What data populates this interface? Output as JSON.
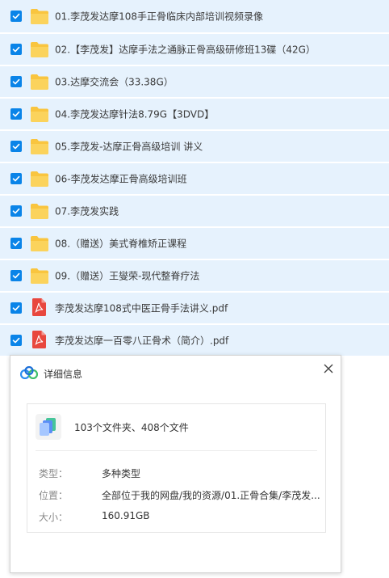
{
  "items": [
    {
      "type": "folder",
      "name": "01.李茂发达摩108手正骨临床内部培训视频录像"
    },
    {
      "type": "folder",
      "name": "02.【李茂发】达摩手法之通脉正骨高级研修班13碟（42G）"
    },
    {
      "type": "folder",
      "name": "03.达摩交流会（33.38G）"
    },
    {
      "type": "folder",
      "name": "04.李茂发达摩针法8.79G【3DVD】"
    },
    {
      "type": "folder",
      "name": "05.李茂发-达摩正骨高级培训 讲义"
    },
    {
      "type": "folder",
      "name": "06-李茂发达摩正骨高级培训班"
    },
    {
      "type": "folder",
      "name": "07.李茂发实践"
    },
    {
      "type": "folder",
      "name": "08.（赠送）美式脊椎矫正课程"
    },
    {
      "type": "folder",
      "name": "09.（赠送）王燮荣-现代整脊疗法"
    },
    {
      "type": "pdf",
      "name": "李茂发达摩108式中医正骨手法讲义.pdf"
    },
    {
      "type": "pdf",
      "name": "李茂发达摩一百零八正骨术（简介）.pdf"
    }
  ],
  "dialog": {
    "title": "详细信息",
    "close_icon": "close-icon",
    "summary": "103个文件夹、408个文件",
    "type_label": "类型：",
    "type_value": "多种类型",
    "location_label": "位置：",
    "location_value": "全部位于我的网盘/我的资源/01.正骨合集/李茂发...",
    "size_label": "大小：",
    "size_value": "160.91GB"
  },
  "colors": {
    "row_bg": "#e6f2fd",
    "checkbox": "#0a84e8",
    "folder": "#f9c53f",
    "pdf": "#e8473e"
  }
}
